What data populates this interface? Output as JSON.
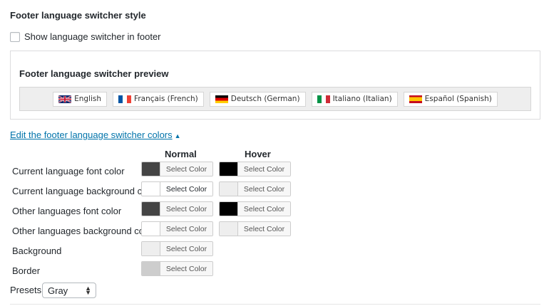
{
  "section_title": "Footer language switcher style",
  "checkbox": {
    "label": "Show language switcher in footer",
    "checked": false
  },
  "preview": {
    "title": "Footer language switcher preview",
    "languages": [
      {
        "label": "English",
        "flag": "uk-flag"
      },
      {
        "label": "Français (French)",
        "flag": "france-flag"
      },
      {
        "label": "Deutsch (German)",
        "flag": "germany-flag"
      },
      {
        "label": "Italiano (Italian)",
        "flag": "italy-flag"
      },
      {
        "label": "Español (Spanish)",
        "flag": "spain-flag"
      }
    ]
  },
  "edit_link": {
    "label": "Edit the footer language switcher colors",
    "icon": "caret-up-icon"
  },
  "columns": {
    "normal": "Normal",
    "hover": "Hover"
  },
  "select_color_label": "Select Color",
  "color_rows": [
    {
      "label": "Current language font color",
      "normal": "#444444",
      "hover": "#000000"
    },
    {
      "label": "Current language background color",
      "normal": "#ffffff",
      "hover": "#eeeeee"
    },
    {
      "label": "Other languages font color",
      "normal": "#444444",
      "hover": "#000000"
    },
    {
      "label": "Other languages background color",
      "normal": "#ffffff",
      "hover": "#eeeeee"
    },
    {
      "label": "Background",
      "normal": "#eeeeee"
    },
    {
      "label": "Border",
      "normal": "#cdcdcd"
    }
  ],
  "presets": {
    "label": "Presets:",
    "selected": "Gray"
  },
  "colors": {
    "link": "#0073aa",
    "text": "#23282d"
  }
}
